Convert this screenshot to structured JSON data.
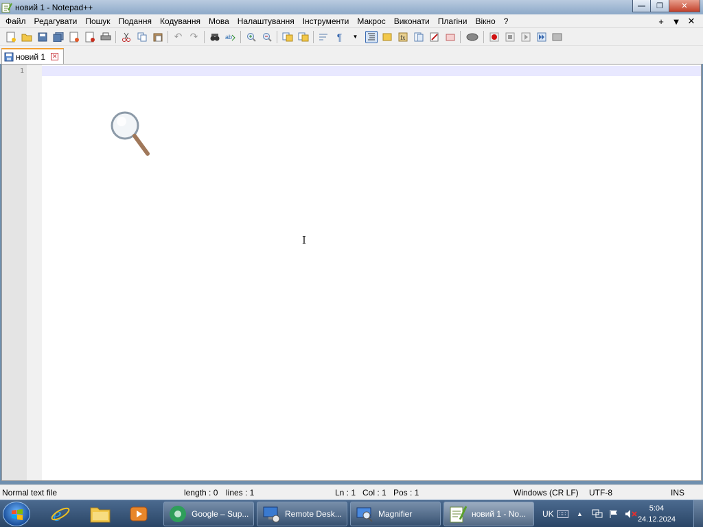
{
  "window": {
    "title": "новий 1 - Notepad++"
  },
  "menu": {
    "items": [
      "Файл",
      "Редагувати",
      "Пошук",
      "Подання",
      "Кодування",
      "Мова",
      "Налаштування",
      "Інструменти",
      "Макрос",
      "Виконати",
      "Плагіни",
      "Вікно",
      "?"
    ],
    "right": [
      "+",
      "▼",
      "✕"
    ]
  },
  "tab": {
    "label": "новий 1"
  },
  "editor": {
    "line_number": "1"
  },
  "status": {
    "file_type": "Normal text file",
    "length": "length : 0",
    "lines": "lines : 1",
    "ln": "Ln : 1",
    "col": "Col : 1",
    "pos": "Pos : 1",
    "eol": "Windows (CR LF)",
    "encoding": "UTF-8",
    "mode": "INS"
  },
  "taskbar": {
    "tasks": [
      {
        "label": "Google – Sup..."
      },
      {
        "label": "Remote Desk..."
      },
      {
        "label": "Magnifier"
      },
      {
        "label": "новий 1 - No..."
      }
    ],
    "language": "UK",
    "time": "5:04",
    "date": "24.12.2024"
  },
  "colors": {
    "accent_tab": "#f4a030",
    "current_line": "#e8e8ff",
    "taskbar": "#2a4566"
  }
}
